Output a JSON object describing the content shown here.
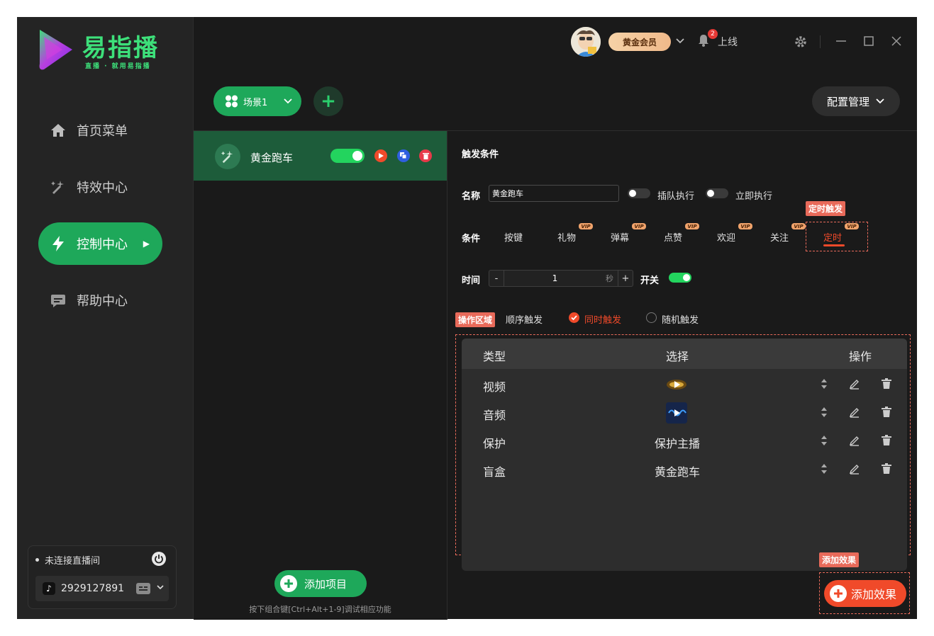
{
  "app": {
    "logo_title": "易指播",
    "logo_subtitle": "直播 · 就用易指播"
  },
  "sidebar": {
    "items": [
      {
        "label": "首页菜单",
        "icon": "home-icon",
        "active": false
      },
      {
        "label": "特效中心",
        "icon": "magic-icon",
        "active": false
      },
      {
        "label": "控制中心",
        "icon": "lightning-icon",
        "active": true
      },
      {
        "label": "帮助中心",
        "icon": "chat-icon",
        "active": false
      }
    ],
    "connection": {
      "status": "未连接直播间",
      "account": "2929127891"
    }
  },
  "topbar": {
    "vip_label": "黄金会员",
    "notification_count": "2",
    "online_label": "上线"
  },
  "scene": {
    "current": "场景1",
    "config_label": "配置管理"
  },
  "projects": {
    "items": [
      {
        "name": "黄金跑车",
        "enabled": true
      }
    ],
    "add_label": "添加项目",
    "hint": "按下组合键[Ctrl+Alt+1-9]调试相应功能"
  },
  "trigger": {
    "section_title": "触发条件",
    "name_label": "名称",
    "name_value": "黄金跑车",
    "queue_label": "插队执行",
    "immediate_label": "立即执行",
    "condition_label": "条件",
    "conditions": [
      {
        "label": "按键",
        "vip": false
      },
      {
        "label": "礼物",
        "vip": true
      },
      {
        "label": "弹幕",
        "vip": true
      },
      {
        "label": "点赞",
        "vip": true
      },
      {
        "label": "欢迎",
        "vip": true
      },
      {
        "label": "关注",
        "vip": true
      },
      {
        "label": "定时",
        "vip": true,
        "selected": true
      }
    ],
    "vip_tag": "VIP",
    "timer_annotation": "定时触发",
    "time_label": "时间",
    "time_value": "1",
    "time_unit": "秒",
    "minus": "-",
    "plus": "+",
    "switch_label": "开关",
    "switch_on": true
  },
  "operation": {
    "annotation": "操作区域",
    "modes": [
      {
        "label": "顺序触发",
        "selected": false
      },
      {
        "label": "同时触发",
        "selected": true
      },
      {
        "label": "随机触发",
        "selected": false
      }
    ],
    "columns": [
      "类型",
      "选择",
      "操作"
    ],
    "rows": [
      {
        "type": "视频",
        "choice": "",
        "thumb": "video-thumbnail"
      },
      {
        "type": "音频",
        "choice": "",
        "thumb": "audio-thumbnail"
      },
      {
        "type": "保护",
        "choice": "保护主播"
      },
      {
        "type": "盲盒",
        "choice": "黄金跑车"
      }
    ],
    "add_annotation": "添加效果",
    "add_label": "添加效果"
  },
  "colors": {
    "accent_green": "#1ea85a",
    "accent_red": "#f04a2a",
    "annotation_red": "#e86a5a",
    "vip_gold": "#f0b98a"
  }
}
